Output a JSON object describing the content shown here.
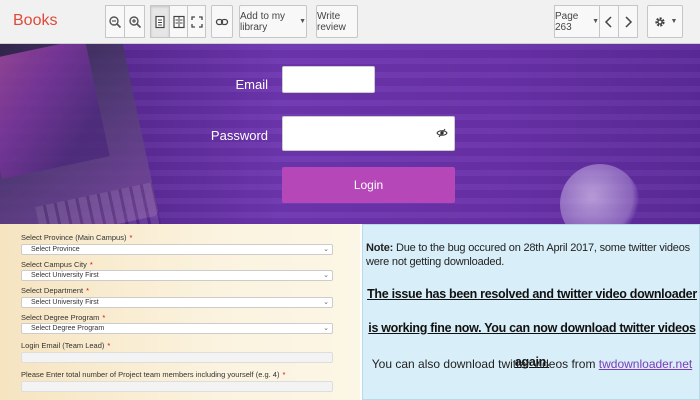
{
  "toolbar": {
    "brand": "Books",
    "add_to_library": "Add to my library",
    "write_review": "Write review",
    "page_label": "Page 263"
  },
  "login": {
    "email_label": "Email",
    "password_label": "Password",
    "email_value": "",
    "password_value": "",
    "button": "Login"
  },
  "form": {
    "province_label": "Select Province (Main Campus)",
    "province_value": "Select Province",
    "city_label": "Select Campus City",
    "city_value": "Select University First",
    "department_label": "Select Department",
    "department_value": "Select University First",
    "degree_label": "Select Degree Program",
    "degree_value": "Select Degree Program",
    "email_label": "Login Email (Team Lead)",
    "members_label": "Please Enter total number of Project team members including yourself (e.g. 4)",
    "required_mark": "*"
  },
  "notice": {
    "note_prefix": "Note:",
    "note_text": " Due to the bug occured on 28th April 2017, some twitter videos were not getting downloaded.",
    "resolved": "The issue has been resolved and twitter video downloader is working fine now. You can now download twitter videos again.",
    "also_text": "You can also download twitter videos from ",
    "link_text": "twdownloader.net"
  }
}
